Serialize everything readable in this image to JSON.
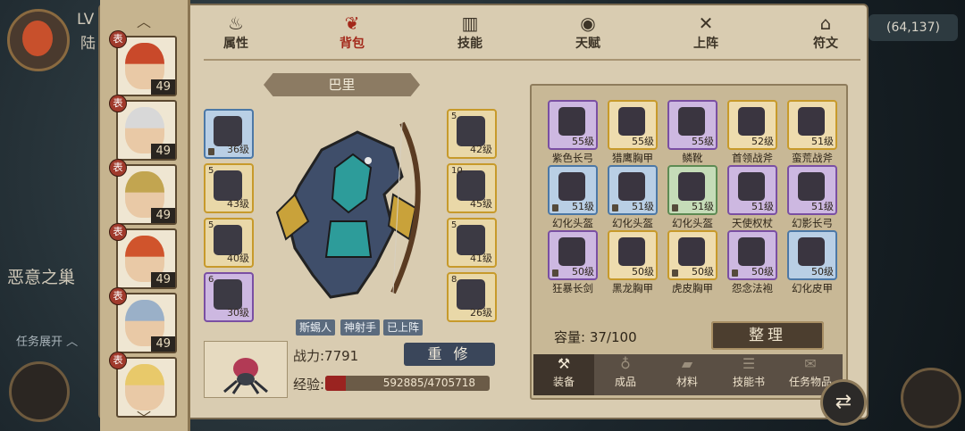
{
  "world": {
    "level_prefix": "LV",
    "player_name_fragment": "陆",
    "location_label": "恶意之巢",
    "quest_toggle_label": "任务展开",
    "coords_label": "(64,137)"
  },
  "roster": {
    "heroes": [
      {
        "level": "49",
        "hair": "#c9492a",
        "tag": "表"
      },
      {
        "level": "49",
        "hair": "#d8d8d8",
        "tag": "表"
      },
      {
        "level": "49",
        "hair": "#c2a550",
        "tag": "表"
      },
      {
        "level": "49",
        "hair": "#d0542c",
        "tag": "表"
      },
      {
        "level": "49",
        "hair": "#9ab0c8",
        "tag": "表"
      },
      {
        "level": "",
        "hair": "#e8c96a",
        "tag": "表"
      }
    ]
  },
  "tabs": [
    {
      "label": "属性",
      "icon": "flame-icon",
      "glyph": "♨"
    },
    {
      "label": "背包",
      "icon": "bag-icon",
      "glyph": "❦"
    },
    {
      "label": "技能",
      "icon": "book-icon",
      "glyph": "▥"
    },
    {
      "label": "天赋",
      "icon": "eye-icon",
      "glyph": "◉"
    },
    {
      "label": "上阵",
      "icon": "crossed-swords-icon",
      "glyph": "✕"
    },
    {
      "label": "符文",
      "icon": "rune-icon",
      "glyph": "⌂"
    }
  ],
  "active_tab": "背包",
  "hero": {
    "name": "巴里",
    "traits": [
      "斯蜴人",
      "神射手",
      "已上阵"
    ],
    "power_label": "战力:7791",
    "reset_button": "重 修",
    "exp_label": "经验:",
    "exp_text": "592885/4705718",
    "exp_fraction": 0.126
  },
  "equipment_left": [
    {
      "level": "36级",
      "num": "",
      "rarity": "blue",
      "locked": true
    },
    {
      "level": "43级",
      "num": "5",
      "rarity": "gold",
      "locked": false
    },
    {
      "level": "40级",
      "num": "5",
      "rarity": "gold",
      "locked": false
    },
    {
      "level": "30级",
      "num": "6",
      "rarity": "purple",
      "locked": false
    }
  ],
  "equipment_right": [
    {
      "level": "42级",
      "num": "5",
      "rarity": "gold",
      "locked": false
    },
    {
      "level": "45级",
      "num": "10",
      "rarity": "gold",
      "locked": false
    },
    {
      "level": "41级",
      "num": "5",
      "rarity": "gold",
      "locked": false
    },
    {
      "level": "26级",
      "num": "8",
      "rarity": "gold",
      "locked": false
    }
  ],
  "inventory": {
    "items": [
      {
        "name": "紫色长弓",
        "level": "55级",
        "rarity": "purple",
        "locked": false
      },
      {
        "name": "猎鹰胸甲",
        "level": "55级",
        "rarity": "gold",
        "locked": false
      },
      {
        "name": "鳞靴",
        "level": "55级",
        "rarity": "purple",
        "locked": false
      },
      {
        "name": "首领战斧",
        "level": "52级",
        "rarity": "gold",
        "locked": false
      },
      {
        "name": "蛮荒战斧",
        "level": "51级",
        "rarity": "gold",
        "locked": false
      },
      {
        "name": "幻化头盔",
        "level": "51级",
        "rarity": "blue",
        "locked": true
      },
      {
        "name": "幻化头盔",
        "level": "51级",
        "rarity": "blue",
        "locked": true
      },
      {
        "name": "幻化头盔",
        "level": "51级",
        "rarity": "green",
        "locked": true
      },
      {
        "name": "天使权杖",
        "level": "51级",
        "rarity": "purple",
        "locked": false
      },
      {
        "name": "幻影长弓",
        "level": "51级",
        "rarity": "purple",
        "locked": false
      },
      {
        "name": "狂暴长剑",
        "level": "50级",
        "rarity": "purple",
        "locked": true
      },
      {
        "name": "黑龙胸甲",
        "level": "50级",
        "rarity": "gold",
        "locked": false
      },
      {
        "name": "虎皮胸甲",
        "level": "50级",
        "rarity": "gold",
        "locked": true
      },
      {
        "name": "怨念法袍",
        "level": "50级",
        "rarity": "purple",
        "locked": true
      },
      {
        "name": "幻化皮甲",
        "level": "50级",
        "rarity": "blue",
        "locked": false
      }
    ],
    "capacity_label": "容量:",
    "capacity_value": "37/100",
    "sort_button": "整理"
  },
  "bag_tabs": [
    {
      "label": "装备",
      "icon": "hammer-icon",
      "glyph": "⚒"
    },
    {
      "label": "成品",
      "icon": "pouch-icon",
      "glyph": "♁"
    },
    {
      "label": "材料",
      "icon": "ingot-icon",
      "glyph": "▰"
    },
    {
      "label": "技能书",
      "icon": "scroll-icon",
      "glyph": "☰"
    },
    {
      "label": "任务物品",
      "icon": "quest-scroll-icon",
      "glyph": "✉"
    }
  ],
  "active_bag_tab": "装备"
}
